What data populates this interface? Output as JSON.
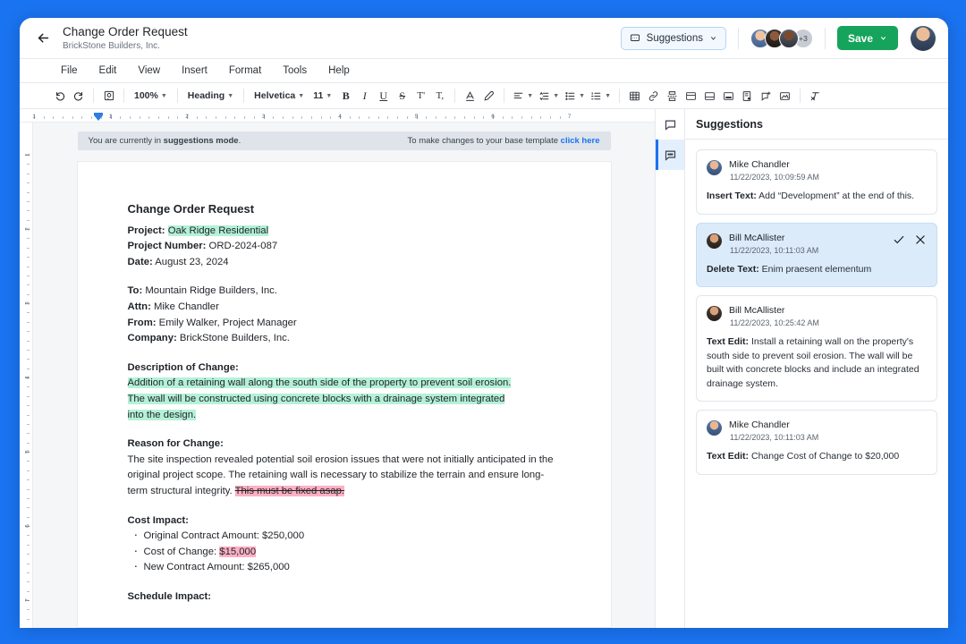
{
  "header": {
    "back_icon": "arrow-left-icon",
    "title": "Change Order Request",
    "subtitle": "BrickStone Builders, Inc.",
    "suggestions_pill": "Suggestions",
    "avatar_overflow": "+3",
    "save_label": "Save"
  },
  "menubar": {
    "items": [
      "File",
      "Edit",
      "View",
      "Insert",
      "Format",
      "Tools",
      "Help"
    ]
  },
  "toolbar": {
    "zoom": "100%",
    "style": "Heading",
    "font": "Helvetica",
    "size": "11",
    "bold": "B",
    "italic": "I",
    "underline": "U",
    "strikethrough": "S",
    "superscript": "T'",
    "subscript": "T,"
  },
  "ruler": {
    "horizontal_numbers": [
      "1",
      "1",
      "2",
      "3",
      "4",
      "5",
      "6",
      "7"
    ],
    "vertical_numbers": [
      "1",
      "2",
      "3",
      "4",
      "5",
      "6",
      "7"
    ]
  },
  "banner": {
    "prefix": "You are currently in ",
    "mode": "suggestions mode",
    "suffix": ".",
    "right_text": "To make changes to your base template ",
    "link": "click here"
  },
  "document": {
    "title": "Change Order Request",
    "fields": [
      {
        "label": "Project:",
        "value": "Oak Ridge Residential",
        "highlight": "green"
      },
      {
        "label": "Project Number:",
        "value": "ORD-2024-087",
        "highlight": "none"
      },
      {
        "label": "Date:",
        "value": "August 23, 2024",
        "highlight": "none"
      }
    ],
    "recipients": [
      {
        "label": "To:",
        "value": "Mountain Ridge Builders, Inc."
      },
      {
        "label": "Attn:",
        "value": "Mike Chandler"
      },
      {
        "label": "From:",
        "value": "Emily Walker, Project Manager"
      },
      {
        "label": "Company:",
        "value": "BrickStone Builders, Inc."
      }
    ],
    "description_heading": "Description of Change:",
    "description_line1": "Addition of a retaining wall along the south side of the property to prevent soil erosion.",
    "description_line2": "The wall will be constructed using concrete blocks with a drainage system integrated",
    "description_line3": "into the design.",
    "reason_heading": "Reason for Change:",
    "reason_body": "The site inspection revealed potential soil erosion issues that were not initially anticipated in the original project scope. The retaining wall is necessary to stabilize the terrain and ensure long-term structural integrity. ",
    "reason_struck": "This must be fixed asap.",
    "cost_heading": "Cost Impact:",
    "cost_items": [
      {
        "label": "Original Contract Amount: ",
        "value": "$250,000",
        "highlight": "none"
      },
      {
        "label": "Cost of Change: ",
        "value": "$15,000",
        "highlight": "pink"
      },
      {
        "label": "New Contract Amount: ",
        "value": "$265,000",
        "highlight": "none"
      }
    ],
    "schedule_heading": "Schedule Impact:"
  },
  "rail": {
    "comment_icon": "comment-icon",
    "suggestion_icon": "suggestion-icon"
  },
  "panel": {
    "title": "Suggestions",
    "cards": [
      {
        "author": "Mike Chandler",
        "avatar": "mike",
        "time": "11/22/2023, 10:09:59 AM",
        "kind": "Insert Text:",
        "text": " Add “Development” at the end of this.",
        "selected": false
      },
      {
        "author": "Bill McAllister",
        "avatar": "bill",
        "time": "11/22/2023, 10:11:03 AM",
        "kind": "Delete Text:",
        "text": " Enim praesent elementum",
        "selected": true
      },
      {
        "author": "Bill McAllister",
        "avatar": "bill",
        "time": "11/22/2023, 10:25:42 AM",
        "kind": "Text Edit:",
        "text": " Install a retaining wall on the property's south side to prevent soil erosion. The wall will be built with concrete blocks and include an integrated drainage system.",
        "selected": false
      },
      {
        "author": "Mike Chandler",
        "avatar": "mike",
        "time": "11/22/2023, 10:11:03 AM",
        "kind": "Text Edit:",
        "text": " Change Cost of Change to $20,000",
        "selected": false
      }
    ],
    "accept_icon": "check-icon",
    "reject_icon": "close-icon"
  },
  "colors": {
    "app_background": "#1a73f0",
    "accent": "#1a73f0",
    "save_green": "#16a45c",
    "highlight_green": "#b4f1d8",
    "highlight_pink": "#fdb0c3",
    "selected_card": "#dcebfa"
  }
}
